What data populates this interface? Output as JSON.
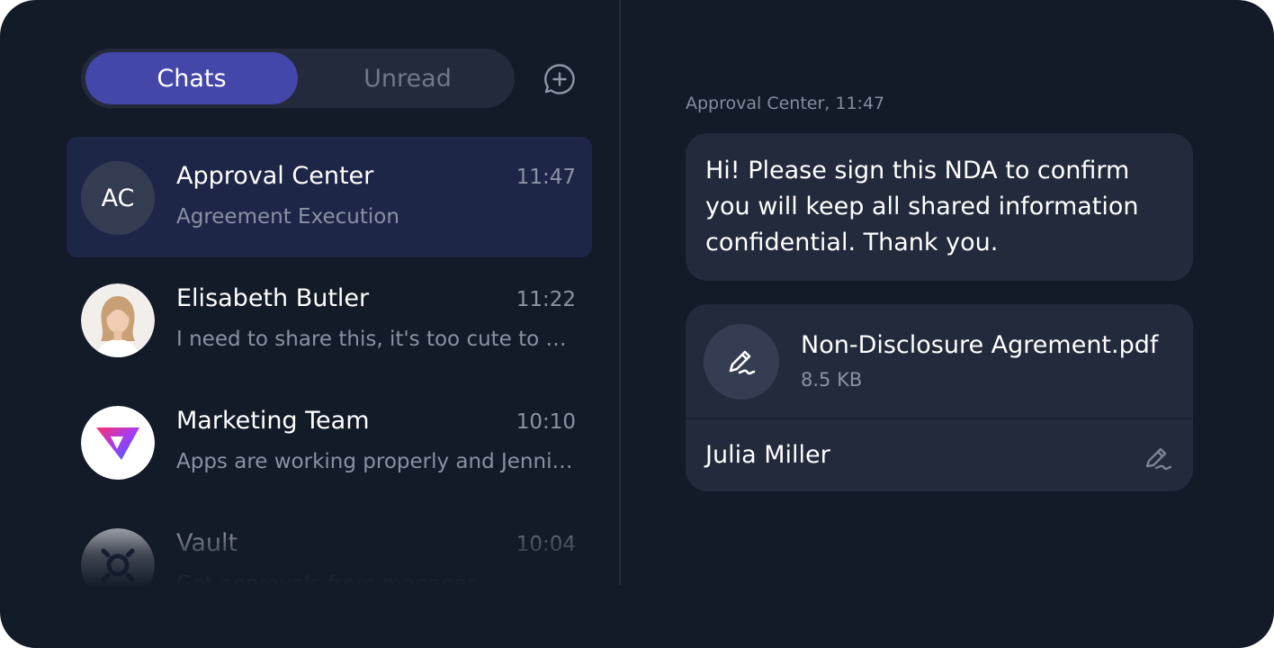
{
  "tabs": {
    "chats": "Chats",
    "unread": "Unread"
  },
  "chats": [
    {
      "initials": "AC",
      "name": "Approval Center",
      "time": "11:47",
      "preview": "Agreement Execution",
      "active": true
    },
    {
      "name": "Elisabeth Butler",
      "time": "11:22",
      "preview": "I need to share this, it's too cute to keep to myself"
    },
    {
      "name": "Marketing Team",
      "time": "10:10",
      "preview": "Apps are working properly and Jennifer said thanks"
    },
    {
      "name": "Vault",
      "time": "10:04",
      "preview": "Get approvals from manager"
    }
  ],
  "conversation": {
    "meta": "Approval Center, 11:47",
    "message": "Hi! Please sign this NDA to confirm you will keep all shared information confidential. Thank you.",
    "document": {
      "name": "Non-Disclosure Agrement.pdf",
      "size": "8.5 KB",
      "signer": "Julia Miller"
    }
  },
  "icons": {
    "new_chat": "chat-plus-icon",
    "document": "signature-pen-icon",
    "sign": "signature-pen-icon"
  },
  "colors": {
    "background": "#131a28",
    "panel": "#222a3b",
    "accent": "#4447a9",
    "active_row": "#1e2648"
  }
}
